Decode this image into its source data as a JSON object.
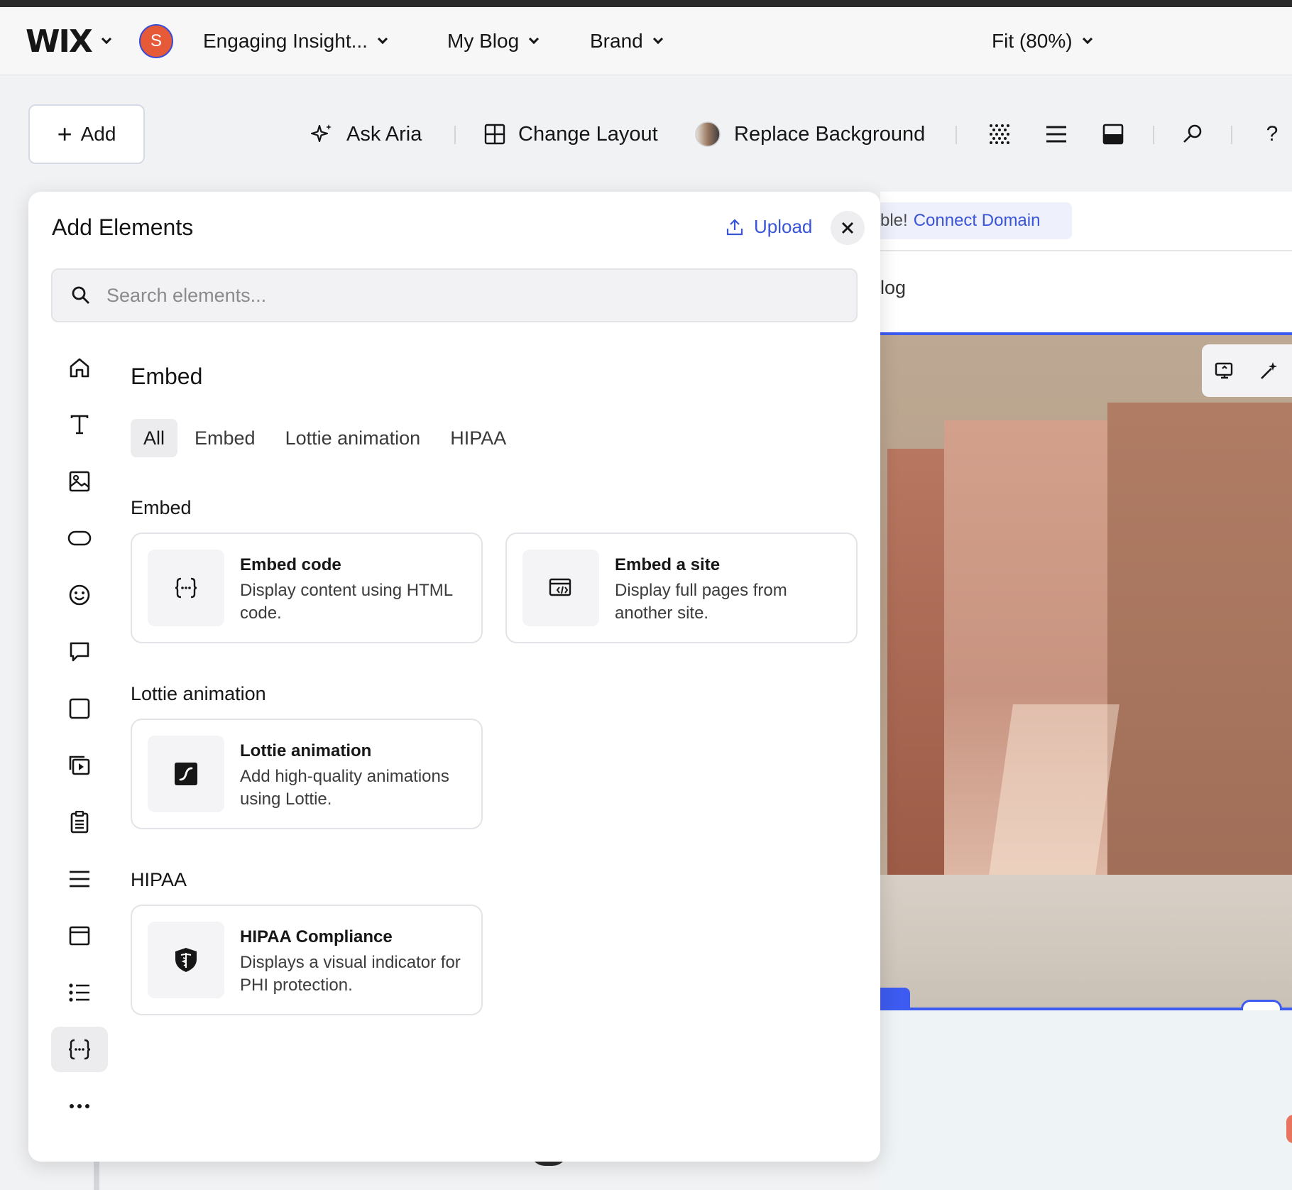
{
  "topbar": {
    "logo": "WIX",
    "avatar_initial": "S",
    "site_name": "Engaging Insight...",
    "blog": "My Blog",
    "brand": "Brand",
    "zoom": "Fit (80%)"
  },
  "toolbar": {
    "add_label": "Add",
    "ask_aria": "Ask Aria",
    "change_layout": "Change Layout",
    "replace_background": "Replace Background",
    "help": "?"
  },
  "canvas": {
    "banner_partial": "ble!",
    "banner_link": "Connect Domain",
    "nav_partial": "log"
  },
  "panel": {
    "title": "Add Elements",
    "upload_label": "Upload",
    "search_placeholder": "Search elements...",
    "section_title": "Embed",
    "filters": [
      "All",
      "Embed",
      "Lottie animation",
      "HIPAA"
    ],
    "groups": [
      {
        "heading": "Embed",
        "cards": [
          {
            "title": "Embed code",
            "desc": "Display content using HTML code.",
            "icon": "code-braces-icon"
          },
          {
            "title": "Embed a site",
            "desc": "Display full pages from another site.",
            "icon": "embed-site-icon"
          }
        ]
      },
      {
        "heading": "Lottie animation",
        "cards": [
          {
            "title": "Lottie animation",
            "desc": "Add high-quality animations using Lottie.",
            "icon": "lottie-icon"
          }
        ]
      },
      {
        "heading": "HIPAA",
        "cards": [
          {
            "title": "HIPAA Compliance",
            "desc": "Displays a visual indicator for PHI protection.",
            "icon": "shield-caduceus-icon"
          }
        ]
      }
    ]
  },
  "colors": {
    "accent_blue": "#3a54d8",
    "canvas_selection": "#3d5bf0",
    "avatar": "#e65a37"
  }
}
